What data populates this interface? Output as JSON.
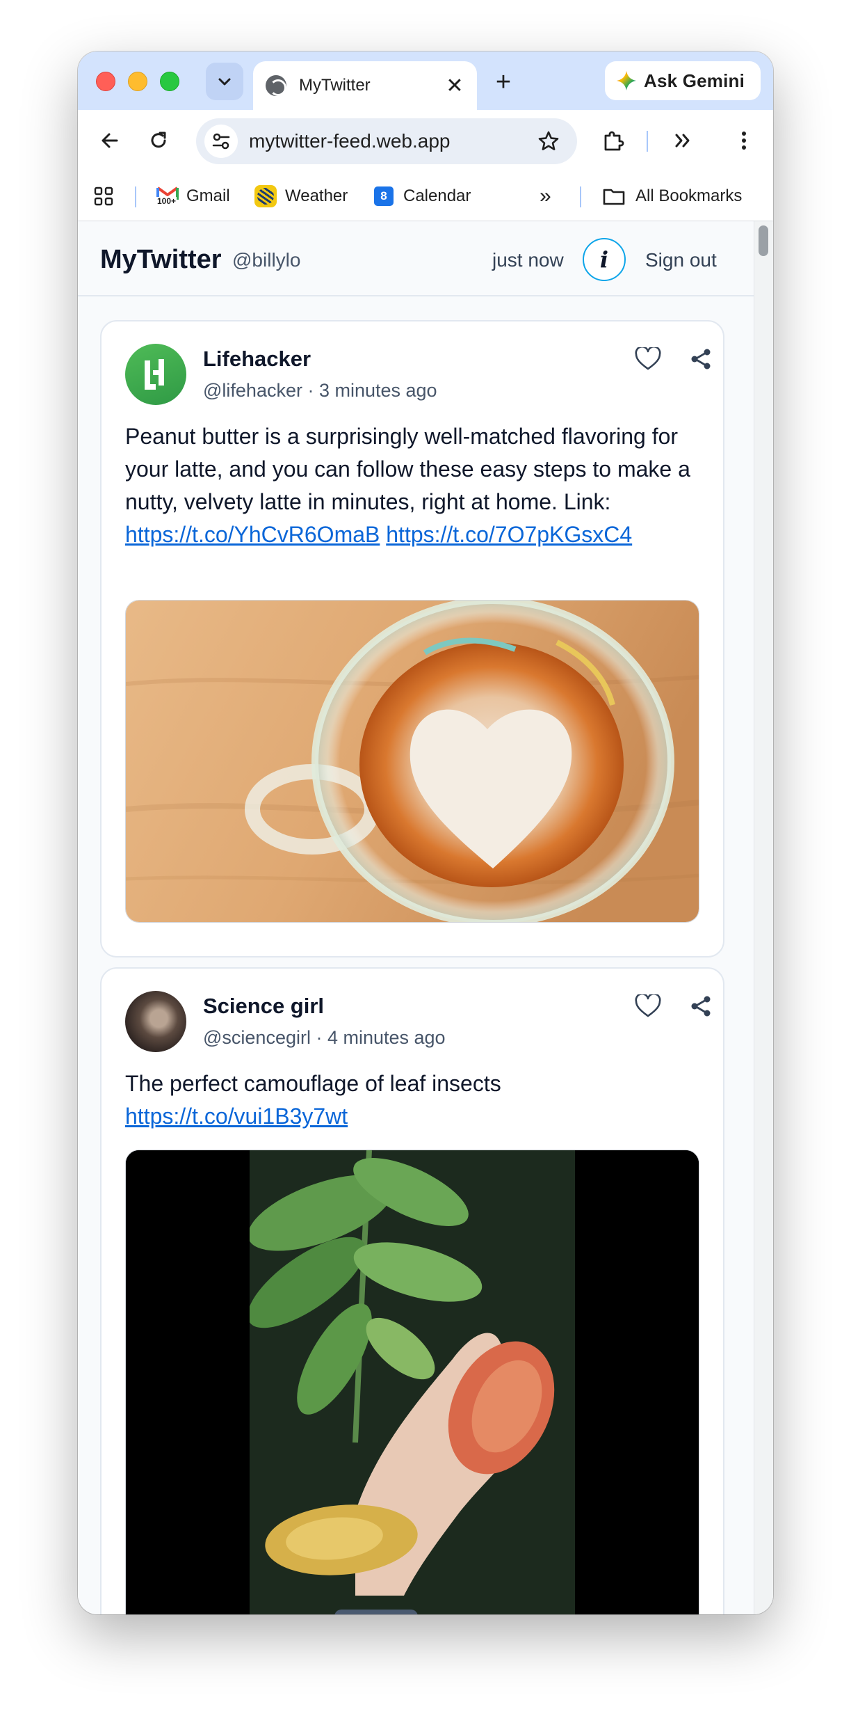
{
  "browser": {
    "tab_title": "MyTwitter",
    "new_tab_symbol": "+",
    "close_symbol": "✕",
    "ask_gemini_label": "Ask Gemini",
    "url": "mytwitter-feed.web.app",
    "bookmarks": {
      "gmail": "Gmail",
      "gmail_badge": "100+",
      "weather": "Weather",
      "calendar": "Calendar",
      "calendar_day": "8",
      "overflow": "»",
      "all_bookmarks": "All Bookmarks"
    }
  },
  "app": {
    "title": "MyTwitter",
    "handle": "@billylo",
    "last_updated": "just now",
    "info_label": "i",
    "sign_out_label": "Sign out"
  },
  "posts": [
    {
      "author": "Lifehacker",
      "meta": "@lifehacker · 3 minutes ago",
      "text": "Peanut butter is a surprisingly well-matched flavoring for your latte, and you can follow these easy steps to make a nutty, velvety latte in minutes, right at home. Link:",
      "links": [
        "https://t.co/YhCvR6OmaB",
        "https://t.co/7O7pKGsxC4"
      ],
      "image": "latte-heart-photo"
    },
    {
      "author": "Science girl",
      "meta": "@sciencegirl · 4 minutes ago",
      "text": "The perfect camouflage of leaf insects",
      "links": [
        "https://t.co/vui1B3y7wt"
      ],
      "image": "leaf-insects-photo"
    }
  ],
  "colors": {
    "tabstrip": "#d3e3fd",
    "link": "#0a66d8",
    "info_ring": "#0ea5e9",
    "lifehacker_green": "#3dab4b"
  }
}
